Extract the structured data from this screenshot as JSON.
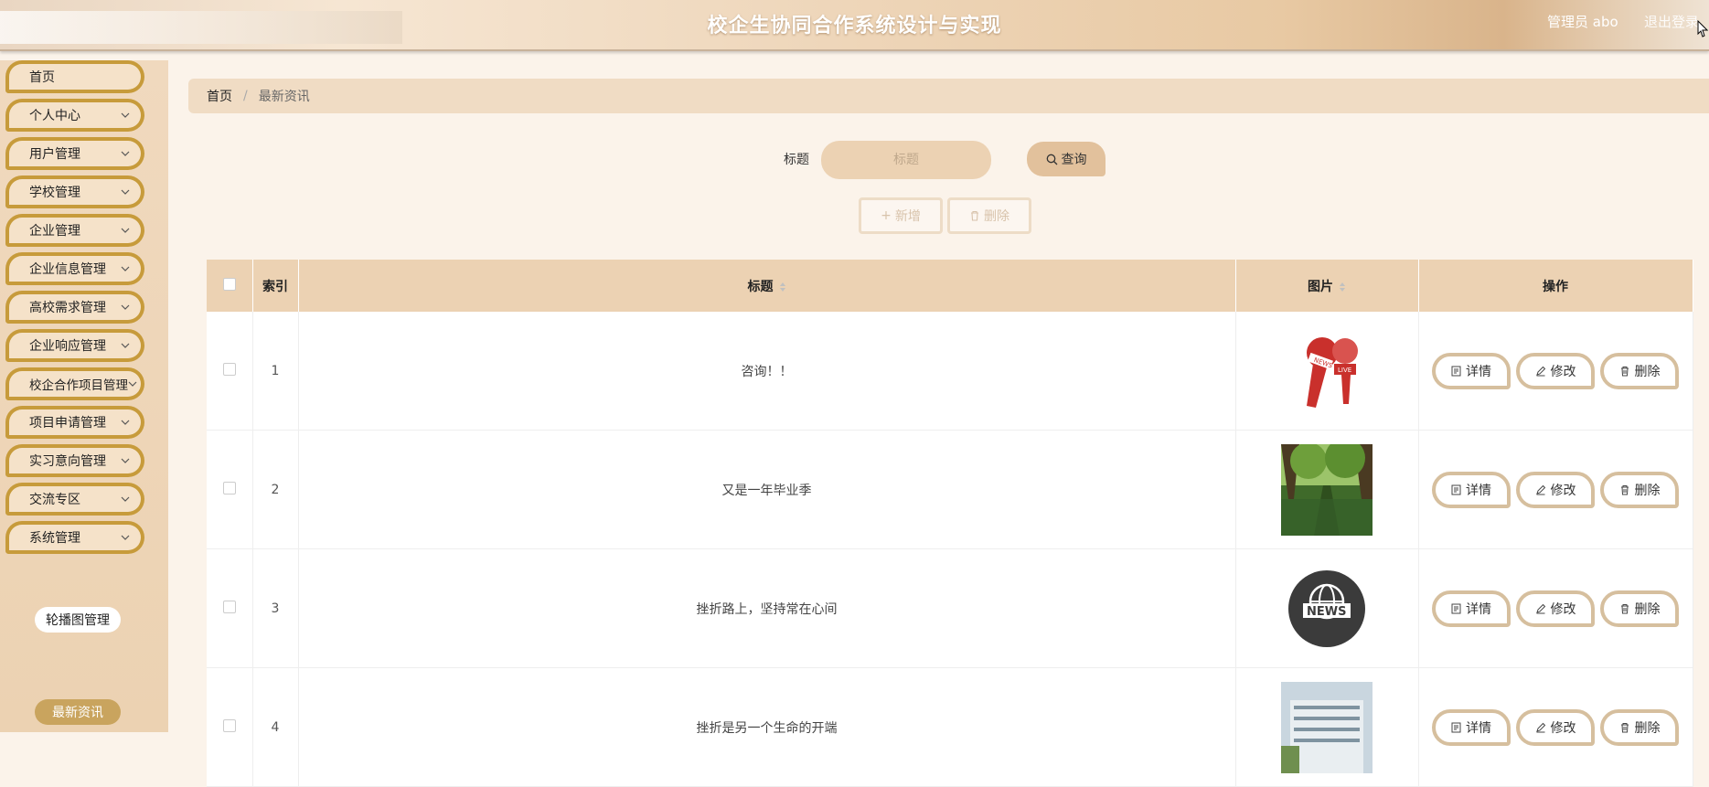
{
  "header": {
    "title": "校企生协同合作系统设计与实现",
    "admin": "管理员 abo",
    "logout": "退出登录"
  },
  "sidebar": {
    "items": [
      {
        "label": "首页",
        "expandable": false
      },
      {
        "label": "个人中心",
        "expandable": true
      },
      {
        "label": "用户管理",
        "expandable": true
      },
      {
        "label": "学校管理",
        "expandable": true
      },
      {
        "label": "企业管理",
        "expandable": true
      },
      {
        "label": "企业信息管理",
        "expandable": true
      },
      {
        "label": "高校需求管理",
        "expandable": true
      },
      {
        "label": "企业响应管理",
        "expandable": true
      },
      {
        "label": "校企合作项目管理",
        "expandable": true
      },
      {
        "label": "项目申请管理",
        "expandable": true
      },
      {
        "label": "实习意向管理",
        "expandable": true
      },
      {
        "label": "交流专区",
        "expandable": true
      },
      {
        "label": "系统管理",
        "expandable": true
      }
    ],
    "subitems": [
      {
        "label": "轮播图管理",
        "active": false
      },
      {
        "label": "最新资讯",
        "active": true
      }
    ]
  },
  "breadcrumb": {
    "home": "首页",
    "separator": "/",
    "current": "最新资讯"
  },
  "search": {
    "label": "标题",
    "placeholder": "标题",
    "button": "查询"
  },
  "actions": {
    "add": "新增",
    "delete": "删除"
  },
  "table": {
    "headers": {
      "index": "索引",
      "title": "标题",
      "image": "图片",
      "ops": "操作"
    },
    "rows": [
      {
        "index": "1",
        "title": "咨询！！",
        "image": "microphone-news-icon"
      },
      {
        "index": "2",
        "title": "又是一年毕业季",
        "image": "forest-path-photo"
      },
      {
        "index": "3",
        "title": "挫折路上，坚持常在心间",
        "image": "news-globe-icon"
      },
      {
        "index": "4",
        "title": "挫折是另一个生命的开端",
        "image": "building-photo"
      }
    ],
    "row_buttons": {
      "detail": "详情",
      "edit": "修改",
      "delete": "删除"
    }
  },
  "colors": {
    "accent": "#c79b3b",
    "header_bg": "#ecd2b3",
    "sidebar_bg": "#f0d9be"
  }
}
